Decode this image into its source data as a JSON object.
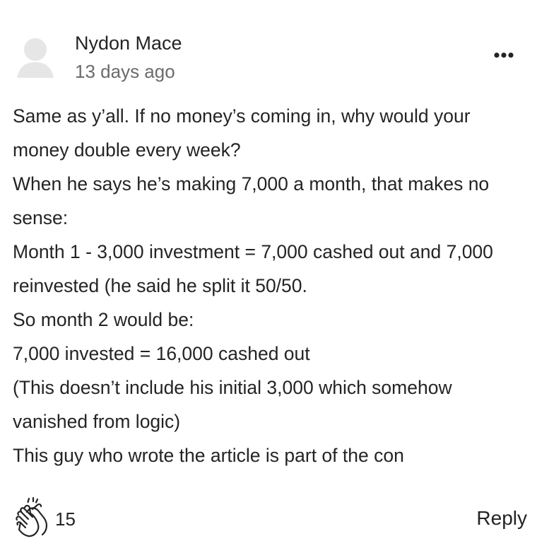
{
  "comment": {
    "author": "Nydon Mace",
    "timestamp": "13 days ago",
    "avatar_icon": "default-avatar-icon",
    "more_icon": "more-options-icon",
    "body_lines": [
      "Same as y’all. If no money’s coming in, why would your",
      "money double every week?",
      "When he says he’s making 7,000 a month, that makes no",
      "sense:",
      "Month 1 - 3,000 investment = 7,000 cashed out and 7,000",
      "reinvested (he said he split it 50/50.",
      "So month 2 would be:",
      "7,000 invested = 16,000 cashed out",
      "(This doesn’t include his initial 3,000 which somehow",
      "vanished from logic)",
      "This guy who wrote the article is part of the con"
    ],
    "clap_icon": "clap-icon",
    "clap_count": "15",
    "reply_label": "Reply"
  },
  "colors": {
    "text": "#242424",
    "muted": "#6b6b6b",
    "avatar_fill": "#e6e6e6"
  }
}
